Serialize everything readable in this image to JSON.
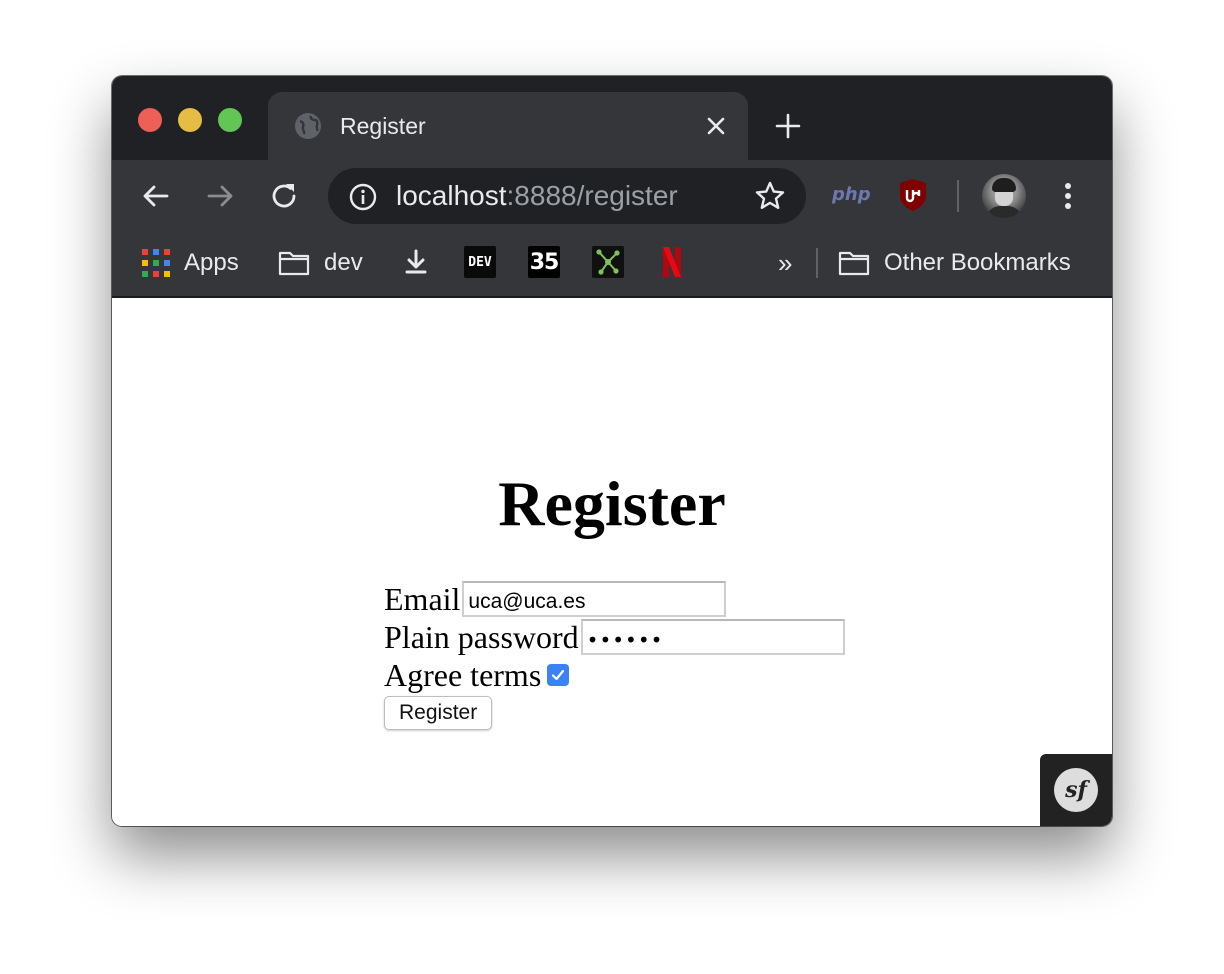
{
  "browser": {
    "tab": {
      "title": "Register"
    },
    "address_bar": {
      "host": "localhost",
      "path": ":8888/register"
    },
    "extensions": {
      "php_label": "php"
    },
    "bookmarks": {
      "apps_label": "Apps",
      "dev_folder_label": "dev",
      "dev_tile_label": "DEV",
      "tile_35_label": "35",
      "overflow_label": "»",
      "other_bookmarks_label": "Other Bookmarks"
    }
  },
  "page": {
    "title": "Register",
    "form": {
      "email_label": "Email",
      "email_value": "uca@uca.es",
      "password_label": "Plain password",
      "password_masked": "••••••",
      "terms_label": "Agree terms",
      "terms_checked": true,
      "submit_label": "Register"
    },
    "debug_toolbar": {
      "logo_text": "sf"
    }
  },
  "colors": {
    "tabstrip_bg": "#202124",
    "toolbar_bg": "#35363a",
    "omnibox_bg": "#202124",
    "checkbox_accent": "#3b82f6",
    "traffic_red": "#ee5f57",
    "traffic_yellow": "#e6bd44",
    "traffic_green": "#62c554"
  },
  "icons": [
    "globe-icon",
    "close-icon",
    "plus-icon",
    "back-arrow-icon",
    "forward-arrow-icon",
    "reload-icon",
    "info-icon",
    "star-icon",
    "ublock-icon",
    "kebab-menu-icon",
    "apps-grid-icon",
    "folder-icon",
    "download-icon",
    "netflix-icon",
    "network-icon"
  ]
}
